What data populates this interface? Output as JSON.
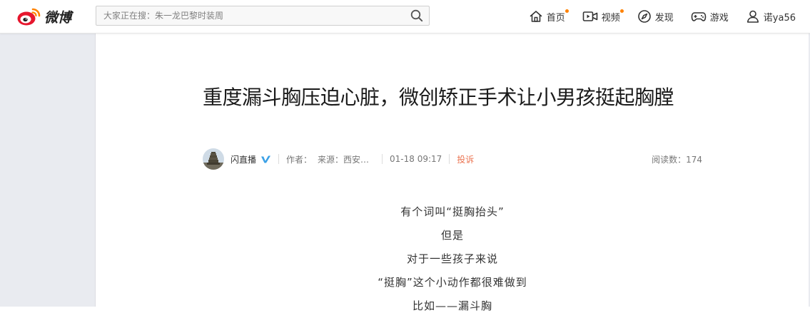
{
  "header": {
    "logo_text": "微博",
    "search": {
      "placeholder": "大家正在搜：朱一龙巴黎时装周"
    },
    "nav": [
      {
        "label": "首页",
        "icon": "home-icon",
        "badge": true
      },
      {
        "label": "视频",
        "icon": "video-icon",
        "badge": true
      },
      {
        "label": "发现",
        "icon": "compass-icon",
        "badge": false
      },
      {
        "label": "游戏",
        "icon": "gamepad-icon",
        "badge": false
      },
      {
        "label": "诺ya56",
        "icon": "user-icon",
        "badge": false
      }
    ]
  },
  "article": {
    "title": "重度漏斗胸压迫心脏，微创矫正手术让小男孩挺起胸膛",
    "author": {
      "name": "闪直播",
      "verified": true
    },
    "meta": {
      "author_label": "作者：",
      "source": "来源：西安市…",
      "datetime": "01-18 09:17",
      "complain_label": "投诉",
      "read_count": "阅读数：174"
    },
    "paragraphs": [
      "有个词叫“挺胸抬头”",
      "但是",
      "对于一些孩子来说",
      "“挺胸”这个小动作都很难做到",
      "比如——漏斗胸"
    ]
  },
  "colors": {
    "accent_orange": "#ff8200",
    "complain": "#eb7350",
    "verify_blue": "#3aa0e6",
    "logo_red": "#e6162d",
    "page_background": "#e9ebf0"
  }
}
